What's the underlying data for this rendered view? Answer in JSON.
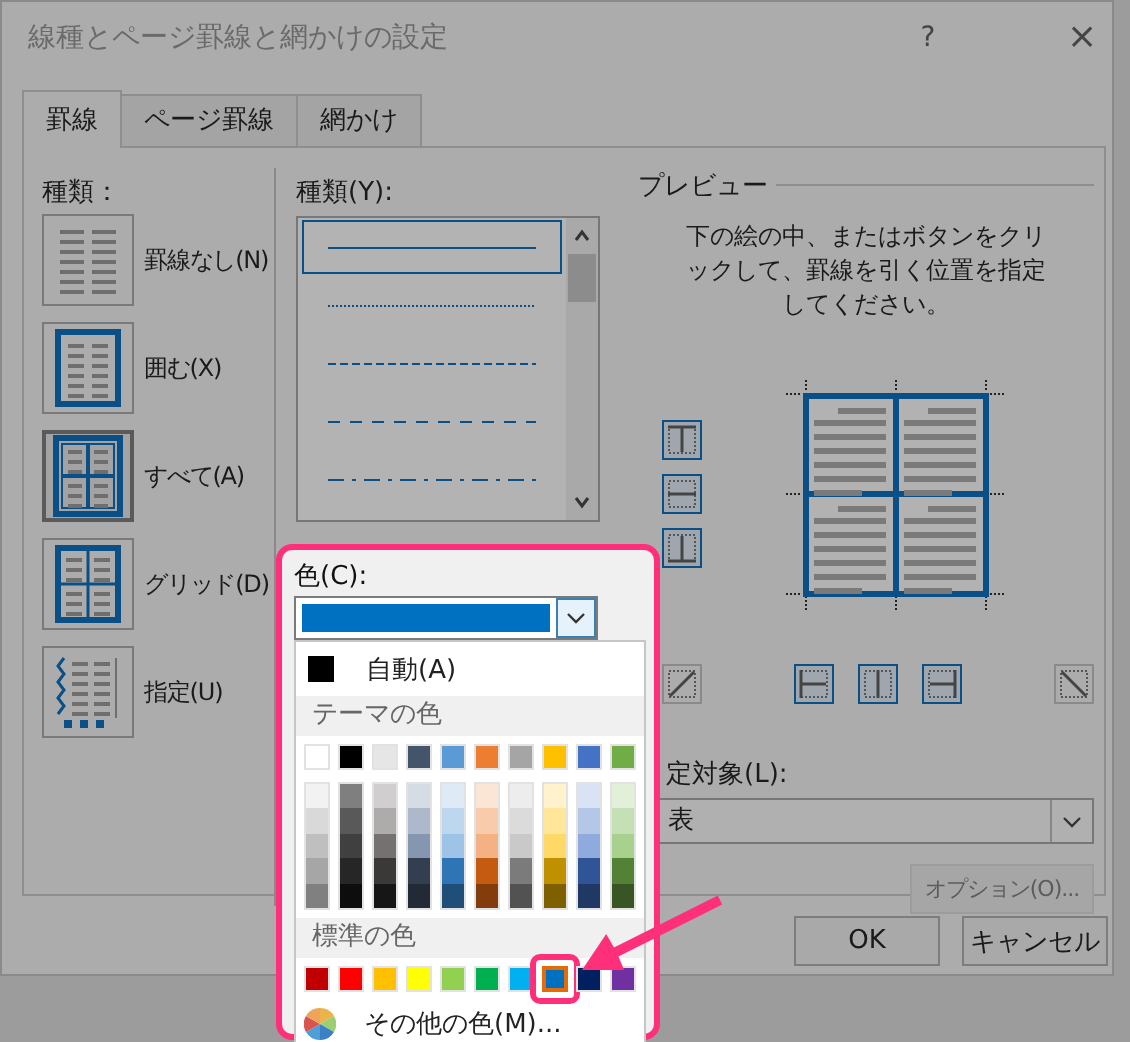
{
  "window": {
    "title": "線種とページ罫線と網かけの設定",
    "help": "?",
    "close": "×"
  },
  "tabs": [
    {
      "label": "罫線",
      "selected": true
    },
    {
      "label": "ページ罫線",
      "selected": false
    },
    {
      "label": "網かけ",
      "selected": false
    }
  ],
  "presets": {
    "label": "種類：",
    "items": [
      {
        "label": "罫線なし(N)",
        "kind": "none",
        "selected": false
      },
      {
        "label": "囲む(X)",
        "kind": "box",
        "selected": false
      },
      {
        "label": "すべて(A)",
        "kind": "all",
        "selected": true
      },
      {
        "label": "グリッド(D)",
        "kind": "grid",
        "selected": false
      },
      {
        "label": "指定(U)",
        "kind": "custom",
        "selected": false
      }
    ]
  },
  "style": {
    "label": "種類(Y):",
    "line_styles": [
      {
        "kind": "solid",
        "selected": true
      },
      {
        "kind": "dotted",
        "selected": false
      },
      {
        "kind": "dashed",
        "selected": false
      },
      {
        "kind": "long-dash",
        "selected": false
      },
      {
        "kind": "dash-dot",
        "selected": false
      }
    ]
  },
  "color": {
    "label": "色(C):",
    "current": {
      "color": "#0070c0"
    },
    "menu": {
      "automatic": {
        "label": "自動(A)",
        "color": "#000000"
      },
      "theme_header": "テーマの色",
      "theme_colors": [
        {
          "color": "#ffffff",
          "shades": [
            {
              "color": "#f2f2f2"
            },
            {
              "color": "#d9d9d9"
            },
            {
              "color": "#bfbfbf"
            },
            {
              "color": "#a6a6a6"
            },
            {
              "color": "#808080"
            }
          ]
        },
        {
          "color": "#000000",
          "shades": [
            {
              "color": "#7f7f7f"
            },
            {
              "color": "#595959"
            },
            {
              "color": "#404040"
            },
            {
              "color": "#262626"
            },
            {
              "color": "#0d0d0d"
            }
          ]
        },
        {
          "color": "#e7e6e6",
          "shades": [
            {
              "color": "#d0cece"
            },
            {
              "color": "#aeabab"
            },
            {
              "color": "#767171"
            },
            {
              "color": "#3b3838"
            },
            {
              "color": "#171616"
            }
          ]
        },
        {
          "color": "#44546a",
          "shades": [
            {
              "color": "#d6dce4"
            },
            {
              "color": "#adb9ca"
            },
            {
              "color": "#8496b0"
            },
            {
              "color": "#333f4f"
            },
            {
              "color": "#222a35"
            }
          ]
        },
        {
          "color": "#5b9bd5",
          "shades": [
            {
              "color": "#deebf6"
            },
            {
              "color": "#bdd7ee"
            },
            {
              "color": "#9dc3e6"
            },
            {
              "color": "#2e75b5"
            },
            {
              "color": "#1f4e79"
            }
          ]
        },
        {
          "color": "#ed7d31",
          "shades": [
            {
              "color": "#fbe5d5"
            },
            {
              "color": "#f8cbad"
            },
            {
              "color": "#f4b183"
            },
            {
              "color": "#c55a11"
            },
            {
              "color": "#833c0b"
            }
          ]
        },
        {
          "color": "#a5a5a5",
          "shades": [
            {
              "color": "#ededed"
            },
            {
              "color": "#dbdbdb"
            },
            {
              "color": "#c9c9c9"
            },
            {
              "color": "#7b7b7b"
            },
            {
              "color": "#525252"
            }
          ]
        },
        {
          "color": "#ffc000",
          "shades": [
            {
              "color": "#fff2cc"
            },
            {
              "color": "#ffe699"
            },
            {
              "color": "#ffd966"
            },
            {
              "color": "#bf9000"
            },
            {
              "color": "#7f6000"
            }
          ]
        },
        {
          "color": "#4472c4",
          "shades": [
            {
              "color": "#dae3f3"
            },
            {
              "color": "#b4c7e7"
            },
            {
              "color": "#8faadc"
            },
            {
              "color": "#2f5597"
            },
            {
              "color": "#203864"
            }
          ]
        },
        {
          "color": "#70ad47",
          "shades": [
            {
              "color": "#e2f0d9"
            },
            {
              "color": "#c5e0b4"
            },
            {
              "color": "#a9d18e"
            },
            {
              "color": "#538135"
            },
            {
              "color": "#375623"
            }
          ]
        }
      ],
      "standard_header": "標準の色",
      "standard_colors": [
        {
          "color": "#c00000",
          "selected": false
        },
        {
          "color": "#ff0000",
          "selected": false
        },
        {
          "color": "#ffc000",
          "selected": false
        },
        {
          "color": "#ffff00",
          "selected": false
        },
        {
          "color": "#92d050",
          "selected": false
        },
        {
          "color": "#00b050",
          "selected": false
        },
        {
          "color": "#00b0f0",
          "selected": false
        },
        {
          "color": "#0070c0",
          "selected": true
        },
        {
          "color": "#002060",
          "selected": false
        },
        {
          "color": "#7030a0",
          "selected": false
        }
      ],
      "more": "その他の色(M)..."
    }
  },
  "preview": {
    "title": "プレビュー",
    "instructions": "下の絵の中、またはボタンをクリックして、罫線を引く位置を指定してください。",
    "side_buttons": [
      {
        "kind": "top",
        "on": true
      },
      {
        "kind": "inside-horizontal",
        "on": true
      },
      {
        "kind": "bottom",
        "on": true
      }
    ],
    "bottom_buttons": [
      {
        "kind": "diagonal-up",
        "on": false
      },
      {
        "kind": "left",
        "on": true
      },
      {
        "kind": "inside-vertical",
        "on": true
      },
      {
        "kind": "right",
        "on": true
      },
      {
        "kind": "diagonal-down",
        "on": false
      }
    ]
  },
  "apply_to": {
    "label": "定対象(L):",
    "value": "表"
  },
  "options_button": {
    "label": "オプション(O)...",
    "disabled": true
  },
  "buttons": [
    "OK",
    "キャンセル"
  ]
}
